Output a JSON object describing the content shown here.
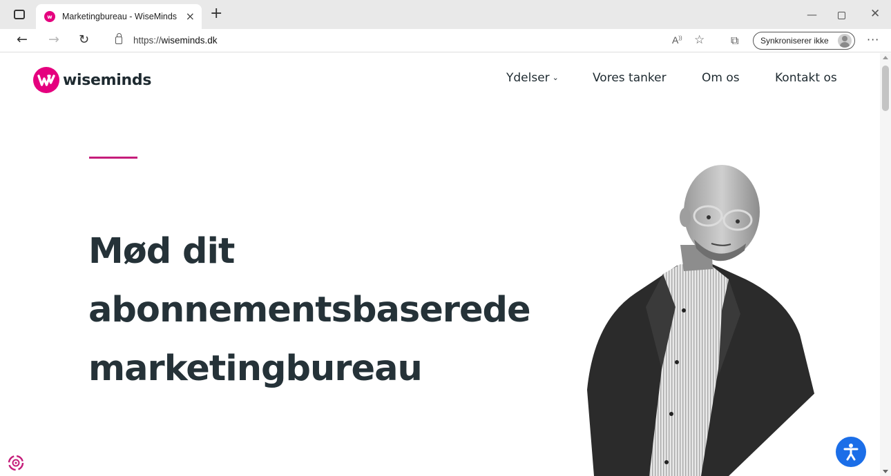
{
  "browser": {
    "tab_title": "Marketingbureau - WiseMinds",
    "tab_close": "×",
    "new_tab": "+",
    "url_prefix": "https://",
    "url_domain": "wiseminds.dk",
    "read_aloud": "A",
    "sync_label": "Synkroniserer ikke",
    "more": "···",
    "window_controls": [
      "minimize",
      "restore",
      "close"
    ]
  },
  "site": {
    "logo_text": "wiseminds",
    "brand_color": "#e5007e",
    "nav": {
      "services": "Ydelser",
      "thoughts": "Vores tanker",
      "about": "Om os",
      "contact": "Kontakt os"
    },
    "hero": {
      "line1": "Mød dit",
      "line2": "abonnementsbaserede",
      "line3": "marketingbureau"
    }
  },
  "icons": {
    "accessibility": "accessibility-icon",
    "cookie": "cookie-settings-icon"
  },
  "colors": {
    "accent": "#c51d7a",
    "headline": "#253238",
    "accessibility_button": "#1b6ee8"
  }
}
